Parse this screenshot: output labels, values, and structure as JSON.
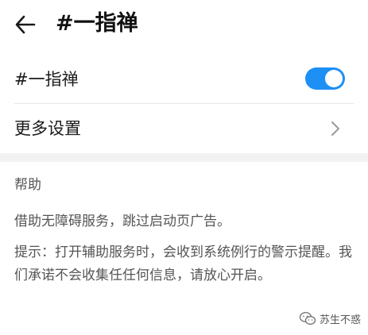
{
  "header": {
    "back_icon": "back-arrow-icon",
    "title": "#一指禅"
  },
  "settings": {
    "toggle_row": {
      "label": "#一指禅",
      "enabled": true,
      "accent_color": "#1e8ff5"
    },
    "more_row": {
      "label": "更多设置",
      "icon": "chevron-right-icon"
    }
  },
  "help": {
    "heading": "帮助",
    "description": "借助无障碍服务，跳过启动页广告。",
    "tip": "提示：打开辅助服务时，会收到系统例行的警示提醒。我们承诺不会收集任任何信息，请放心开启。"
  },
  "watermark": {
    "icon": "wechat-icon",
    "text": "苏生不惑"
  }
}
